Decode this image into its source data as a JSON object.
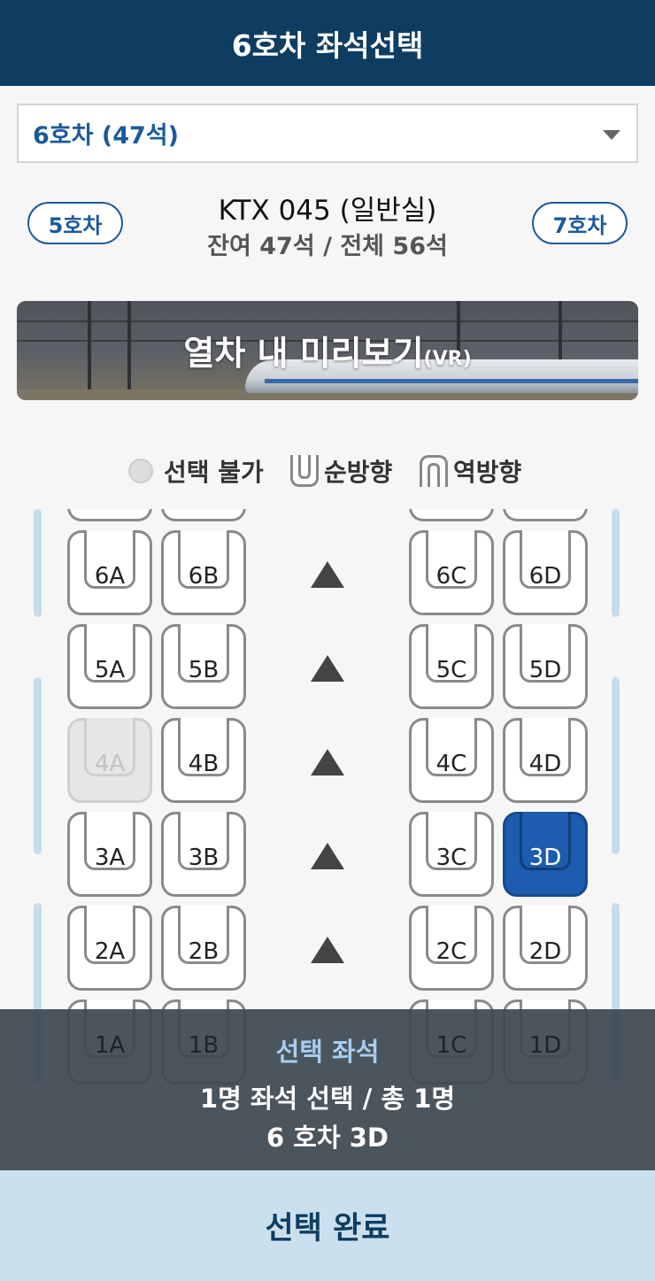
{
  "header": {
    "title": "6호차 좌석선택"
  },
  "car_select": {
    "value": "6호차 (47석)"
  },
  "car_nav": {
    "prev": "5호차",
    "next": "7호차"
  },
  "train_info": {
    "title": "KTX 045 (일반실)",
    "availability": "잔여 47석 / 전체 56석"
  },
  "vr_banner": {
    "label": "열차 내 미리보기",
    "suffix": "(VR)"
  },
  "legend": {
    "unavailable": "선택 불가",
    "forward": "순방향",
    "backward": "역방향"
  },
  "seats": {
    "s6A": "6A",
    "s6B": "6B",
    "s6C": "6C",
    "s6D": "6D",
    "s5A": "5A",
    "s5B": "5B",
    "s5C": "5C",
    "s5D": "5D",
    "s4A": "4A",
    "s4B": "4B",
    "s4C": "4C",
    "s4D": "4D",
    "s3A": "3A",
    "s3B": "3B",
    "s3C": "3C",
    "s3D": "3D",
    "s2A": "2A",
    "s2B": "2B",
    "s2C": "2C",
    "s2D": "2D",
    "s1A": "1A",
    "s1B": "1B",
    "s1C": "1C",
    "s1D": "1D"
  },
  "seat_states": {
    "unavailable": [
      "4A"
    ],
    "selected": [
      "3D"
    ]
  },
  "summary": {
    "title": "선택 좌석",
    "count": "1명 좌석 선택 / 총 1명",
    "seat": "6 호차 3D"
  },
  "footer": {
    "done_label": "선택 완료"
  },
  "colors": {
    "header_bg": "#0f3d62",
    "accent": "#1b5a9a",
    "selected_seat": "#1d5cae",
    "done_bg": "#cbe0ee"
  }
}
